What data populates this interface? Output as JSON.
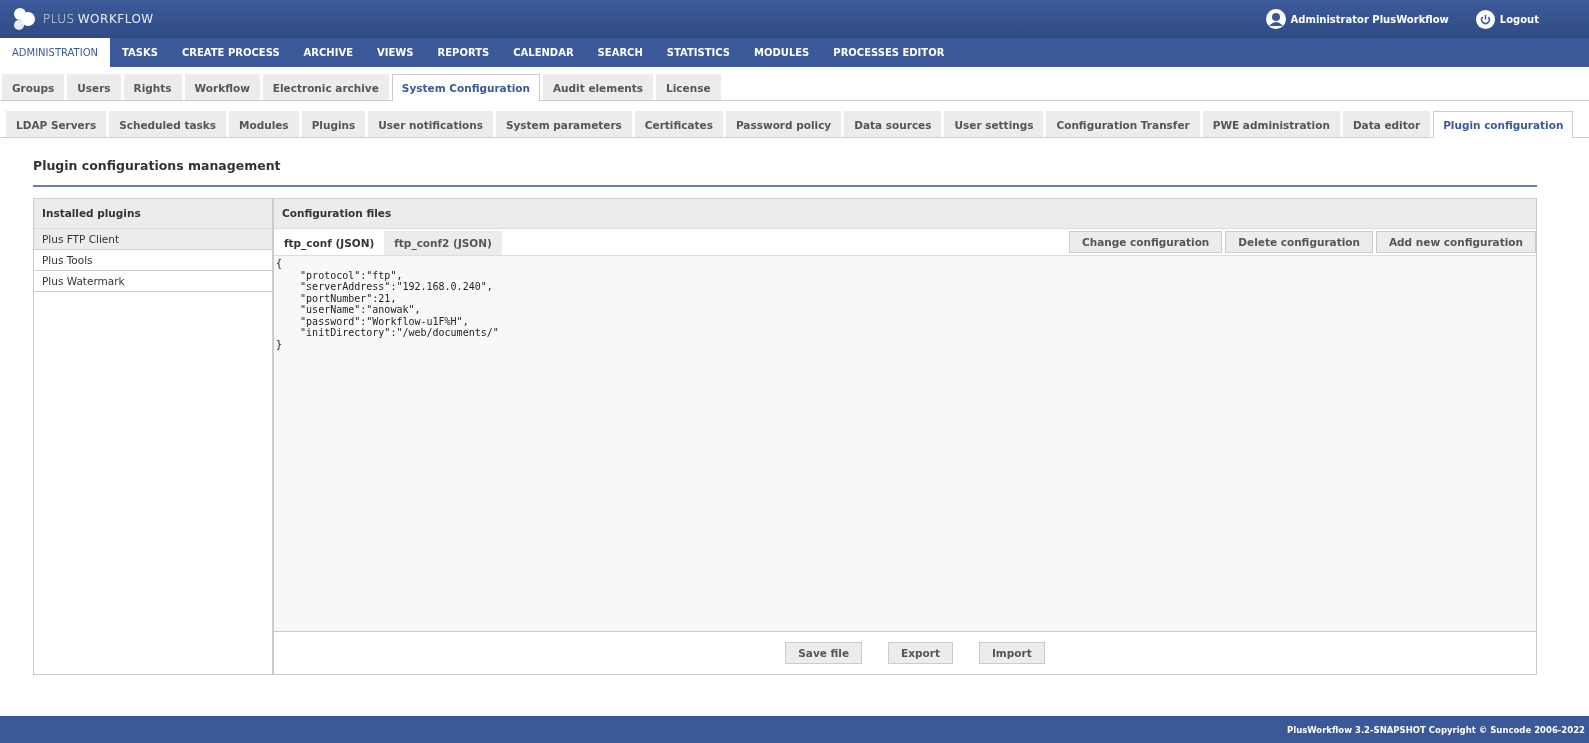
{
  "header": {
    "logo": {
      "first": "PLUS",
      "second": "WORKFLOW"
    },
    "user": "Administrator PlusWorkflow",
    "logout": "Logout"
  },
  "main_menu": [
    {
      "label": "ADMINISTRATION",
      "selected": true
    },
    {
      "label": "TASKS",
      "selected": false
    },
    {
      "label": "CREATE PROCESS",
      "selected": false
    },
    {
      "label": "ARCHIVE",
      "selected": false
    },
    {
      "label": "VIEWS",
      "selected": false
    },
    {
      "label": "REPORTS",
      "selected": false
    },
    {
      "label": "CALENDAR",
      "selected": false
    },
    {
      "label": "SEARCH",
      "selected": false
    },
    {
      "label": "STATISTICS",
      "selected": false
    },
    {
      "label": "MODULES",
      "selected": false
    },
    {
      "label": "PROCESSES EDITOR",
      "selected": false
    }
  ],
  "tabs": [
    {
      "label": "Groups",
      "selected": false
    },
    {
      "label": "Users",
      "selected": false
    },
    {
      "label": "Rights",
      "selected": false
    },
    {
      "label": "Workflow",
      "selected": false
    },
    {
      "label": "Electronic archive",
      "selected": false
    },
    {
      "label": "System Configuration",
      "selected": true
    },
    {
      "label": "Audit elements",
      "selected": false
    },
    {
      "label": "License",
      "selected": false
    }
  ],
  "subtabs": [
    {
      "label": "LDAP Servers",
      "selected": false
    },
    {
      "label": "Scheduled tasks",
      "selected": false
    },
    {
      "label": "Modules",
      "selected": false
    },
    {
      "label": "Plugins",
      "selected": false
    },
    {
      "label": "User notifications",
      "selected": false
    },
    {
      "label": "System parameters",
      "selected": false
    },
    {
      "label": "Certificates",
      "selected": false
    },
    {
      "label": "Password policy",
      "selected": false
    },
    {
      "label": "Data sources",
      "selected": false
    },
    {
      "label": "User settings",
      "selected": false
    },
    {
      "label": "Configuration Transfer",
      "selected": false
    },
    {
      "label": "PWE administration",
      "selected": false
    },
    {
      "label": "Data editor",
      "selected": false
    },
    {
      "label": "Plugin configuration",
      "selected": true
    }
  ],
  "page_title": "Plugin configurations management",
  "plugins": {
    "heading": "Installed plugins",
    "items": [
      {
        "label": "Plus FTP Client",
        "selected": true
      },
      {
        "label": "Plus Tools",
        "selected": false
      },
      {
        "label": "Plus Watermark",
        "selected": false
      }
    ]
  },
  "config": {
    "heading": "Configuration files",
    "file_tabs": [
      {
        "label": "ftp_conf (JSON)",
        "selected": true
      },
      {
        "label": "ftp_conf2 (JSON)",
        "selected": false
      }
    ],
    "actions": [
      "Change configuration",
      "Delete configuration",
      "Add new configuration"
    ],
    "editor_lines": [
      "{",
      "    \"protocol\":\"ftp\",",
      "    \"serverAddress\":\"192.168.0.240\",",
      "    \"portNumber\":21,",
      "    \"userName\":\"anowak\",",
      "    \"password\":\"Workflow-u1F%H\",",
      "    \"initDirectory\":\"/web/documents/\"",
      "}"
    ],
    "footer_buttons": [
      "Save file",
      "Export",
      "Import"
    ]
  },
  "footer": "PlusWorkflow 3.2-SNAPSHOT Copyright © Suncode 2006-2022"
}
